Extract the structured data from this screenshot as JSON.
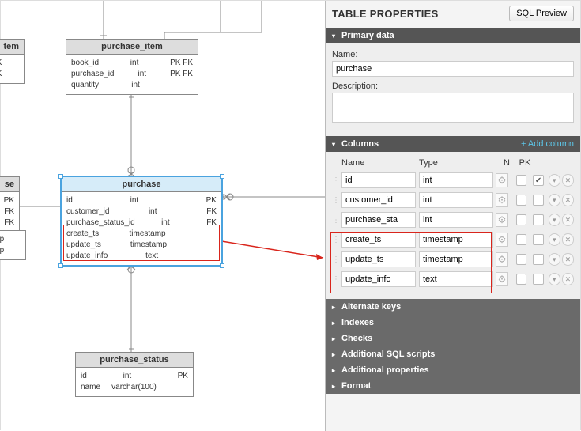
{
  "panel": {
    "title": "TABLE PROPERTIES",
    "sql_preview": "SQL Preview",
    "primary_data": {
      "heading": "Primary data",
      "name_label": "Name:",
      "name_value": "purchase",
      "desc_label": "Description:",
      "desc_value": ""
    },
    "columns_section": {
      "heading": "Columns",
      "add_label": "+ Add column",
      "headers": {
        "name": "Name",
        "type": "Type",
        "n": "N",
        "pk": "PK"
      },
      "rows": [
        {
          "name": "id",
          "type": "int",
          "n": false,
          "pk": true
        },
        {
          "name": "customer_id",
          "type": "int",
          "n": false,
          "pk": false
        },
        {
          "name": "purchase_sta",
          "type": "int",
          "n": false,
          "pk": false
        },
        {
          "name": "create_ts",
          "type": "timestamp",
          "n": false,
          "pk": false
        },
        {
          "name": "update_ts",
          "type": "timestamp",
          "n": false,
          "pk": false
        },
        {
          "name": "update_info",
          "type": "text",
          "n": false,
          "pk": false
        }
      ]
    },
    "collapsed": [
      "Alternate keys",
      "Indexes",
      "Checks",
      "Additional SQL scripts",
      "Additional properties",
      "Format"
    ]
  },
  "erd": {
    "purchase_item": {
      "title": "purchase_item",
      "cols": [
        {
          "name": "book_id",
          "type": "int",
          "key": "PK FK"
        },
        {
          "name": "purchase_id",
          "type": "int",
          "key": "PK FK"
        },
        {
          "name": "quantity",
          "type": "int",
          "key": ""
        }
      ]
    },
    "partial_item": {
      "title": "tem",
      "rows": [
        "t PK FK",
        "t PK FK"
      ]
    },
    "partial_se": {
      "title": "se",
      "rows": [
        "PK",
        "FK",
        "FK"
      ]
    },
    "partial_stamp": {
      "rows": [
        "stamp",
        "stamp"
      ]
    },
    "purchase": {
      "title": "purchase",
      "cols": [
        {
          "name": "id",
          "type": "int",
          "key": "PK"
        },
        {
          "name": "customer_id",
          "type": "int",
          "key": "FK"
        },
        {
          "name": "purchase_status_id",
          "type": "int",
          "key": "FK"
        },
        {
          "name": "create_ts",
          "type": "timestamp",
          "key": ""
        },
        {
          "name": "update_ts",
          "type": "timestamp",
          "key": ""
        },
        {
          "name": "update_info",
          "type": "text",
          "key": ""
        }
      ]
    },
    "purchase_status": {
      "title": "purchase_status",
      "cols": [
        {
          "name": "id",
          "type": "int",
          "key": "PK"
        },
        {
          "name": "name",
          "type": "varchar(100)",
          "key": ""
        }
      ]
    }
  }
}
